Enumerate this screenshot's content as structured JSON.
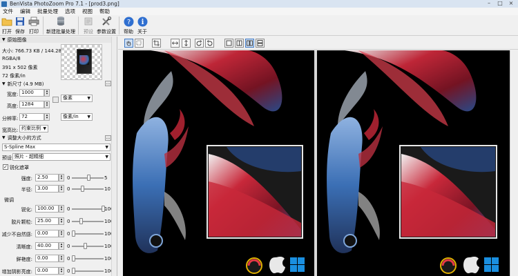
{
  "window": {
    "title": "BenVista PhotoZoom Pro 7.1 - [prod3.png]",
    "controls": [
      "–",
      "□",
      "×"
    ]
  },
  "menu": [
    "文件",
    "编辑",
    "批量处理",
    "选项",
    "视图",
    "帮助"
  ],
  "toolbar": {
    "buttons": [
      {
        "label": "打开",
        "icon": "folder-open-icon"
      },
      {
        "label": "保存",
        "icon": "save-disk-icon"
      },
      {
        "label": "打印",
        "icon": "printer-icon"
      },
      {
        "label": "新建批量处理",
        "icon": "batch-stack-icon"
      },
      {
        "label": "预设",
        "icon": "preset-icon",
        "disabled": true
      },
      {
        "label": "参数设置",
        "icon": "tools-icon"
      },
      {
        "label": "帮助",
        "icon": "help-icon"
      },
      {
        "label": "关于",
        "icon": "info-icon"
      }
    ]
  },
  "sidebar": {
    "original": {
      "header": "原始图像",
      "size": "大小: 766.73 KB / 144.28 KB",
      "mode": "RGBA/8",
      "dims": "391 x 502 像素",
      "dpi": "72 像素/in"
    },
    "new_size": {
      "header": "新尺寸 (4.9 MB)",
      "width_label": "宽度:",
      "width_value": "1000",
      "height_label": "高度:",
      "height_value": "1284",
      "unit_pixels": "像素",
      "resolution_label": "分辨率:",
      "resolution_value": "72",
      "unit_ppi": "像素/in",
      "aspect_label": "宽高比:",
      "aspect_value": "约束比例"
    },
    "resize_method": {
      "header": "调整大小的方式",
      "method": "S-Spline Max",
      "preset_label": "预设:",
      "preset_value": "照片 - 超精细"
    },
    "sharpen": {
      "checkbox_label": "锐化遮罩",
      "rows": [
        {
          "label": "强度:",
          "value": "2.50",
          "min": "0",
          "max": "5",
          "level": 0.5
        },
        {
          "label": "半径:",
          "value": "3.00",
          "min": "0",
          "max": "10",
          "level": 0.3
        }
      ]
    },
    "fine_tune": {
      "header": "微调",
      "rows": [
        {
          "label": "锐化:",
          "value": "100.00",
          "min": "0",
          "max": "100",
          "level": 1.0
        },
        {
          "label": "胶片颗粒:",
          "value": "25.00",
          "min": "0",
          "max": "100",
          "level": 0.25
        },
        {
          "label": "减少不自然感:",
          "value": "0.00",
          "min": "0",
          "max": "100",
          "level": 0.0
        },
        {
          "label": "清晰度:",
          "value": "40.00",
          "min": "0",
          "max": "100",
          "level": 0.4
        },
        {
          "label": "鲜艳度:",
          "value": "0.00",
          "min": "0",
          "max": "100",
          "level": 0.0
        },
        {
          "label": "增加阴影亮度:",
          "value": "0.00",
          "min": "0",
          "max": "100",
          "level": 0.0
        }
      ]
    }
  },
  "colors": {
    "accent": "#3e78c4",
    "fish_blue": "#3b6fb5",
    "fin_red": "#c8283a",
    "windows_blue": "#1a8fe0"
  }
}
